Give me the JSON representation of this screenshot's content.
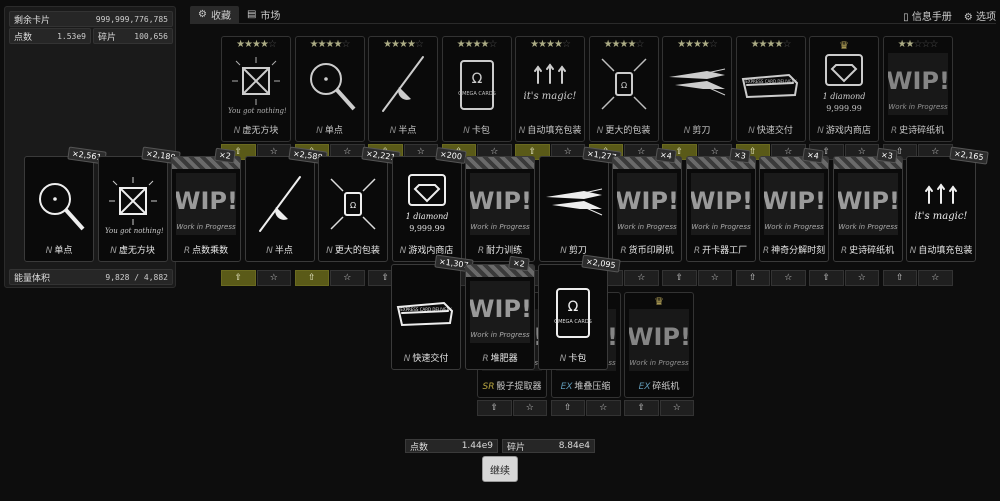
{
  "sidebar": {
    "stats": [
      {
        "label": "剩余卡片",
        "value": "999,999,776,785"
      },
      {
        "label": "点数",
        "value": "1.53e9"
      },
      {
        "label": "碎片",
        "value": "100,656"
      },
      {
        "label": "能量体积",
        "value": "9,828 / 4,882"
      }
    ]
  },
  "tabs": [
    {
      "label": "收藏",
      "icon": "gear-icon"
    },
    {
      "label": "市场",
      "icon": "market-icon"
    }
  ],
  "top_right": [
    {
      "label": "信息手册",
      "icon": "book-icon"
    },
    {
      "label": "选项",
      "icon": "gear-icon"
    }
  ],
  "back_cards": [
    {
      "name": "虚无方块",
      "rarity": "N",
      "stars": 4,
      "art": "box"
    },
    {
      "name": "单点",
      "rarity": "N",
      "stars": 4,
      "art": "dot"
    },
    {
      "name": "半点",
      "rarity": "N",
      "stars": 4,
      "art": "half"
    },
    {
      "name": "卡包",
      "rarity": "N",
      "stars": 4,
      "art": "pack"
    },
    {
      "name": "自动填充包装",
      "rarity": "N",
      "stars": 4,
      "art": "magic"
    },
    {
      "name": "更大的包装",
      "rarity": "N",
      "stars": 4,
      "art": "bigger"
    },
    {
      "name": "剪刀",
      "rarity": "N",
      "stars": 4,
      "art": "scissors"
    },
    {
      "name": "快速交付",
      "rarity": "N",
      "stars": 4,
      "art": "express"
    },
    {
      "name": "游戏内商店",
      "rarity": "N",
      "crown": true,
      "art": "diamond"
    },
    {
      "name": "史诗碎纸机",
      "rarity": "R",
      "stars": 2,
      "art": "wip"
    }
  ],
  "star_total": 5,
  "front_cards": [
    {
      "name": "单点",
      "rarity": "N",
      "count": "×2,561",
      "art": "dot"
    },
    {
      "name": "虚无方块",
      "rarity": "N",
      "count": "×2,189",
      "art": "box"
    },
    {
      "name": "点数乘数",
      "rarity": "R",
      "count": "×2",
      "art": "wip",
      "striped": true
    },
    {
      "name": "半点",
      "rarity": "N",
      "count": "×2,588",
      "art": "half"
    },
    {
      "name": "更大的包装",
      "rarity": "N",
      "count": "×2,221",
      "art": "bigger"
    },
    {
      "name": "游戏内商店",
      "rarity": "N",
      "count": "×200",
      "art": "diamond"
    },
    {
      "name": "耐力训练",
      "rarity": "R",
      "count": "",
      "art": "wip",
      "striped": true
    },
    {
      "name": "剪刀",
      "rarity": "N",
      "count": "×1,277",
      "art": "scissors"
    },
    {
      "name": "货币印刷机",
      "rarity": "R",
      "count": "×4",
      "art": "wip",
      "striped": true
    },
    {
      "name": "开卡器工厂",
      "rarity": "R",
      "count": "×3",
      "art": "wip",
      "striped": true
    },
    {
      "name": "神奇分解时刻",
      "rarity": "R",
      "count": "×4",
      "art": "wip",
      "striped": true
    },
    {
      "name": "史诗碎纸机",
      "rarity": "R",
      "count": "×3",
      "art": "wip",
      "striped": true
    },
    {
      "name": "自动填充包装",
      "rarity": "N",
      "count": "×2,165",
      "art": "magic"
    }
  ],
  "third_row": [
    {
      "name": "快速交付",
      "rarity": "N",
      "count": "×1,307",
      "art": "express"
    },
    {
      "name": "堆肥器",
      "rarity": "R",
      "count": "×2",
      "art": "wip",
      "striped": true
    },
    {
      "name": "卡包",
      "rarity": "N",
      "count": "×2,095",
      "art": "pack"
    }
  ],
  "collection_extras": [
    {
      "name": "骰子提取器",
      "rarity": "SR"
    },
    {
      "name": "堆叠压缩",
      "rarity": "EX"
    },
    {
      "name": "碎纸机",
      "rarity": "EX",
      "crown": true
    }
  ],
  "wip_text": "WIP!",
  "wip_sub": "Work in Progress",
  "art_text": {
    "omega": "Ω",
    "omega_cards": "OMEGA CARDS",
    "magic": "it's magic!",
    "diamond": "1 diamond",
    "diamond_price": "9,999.99",
    "express": "EXPRESS CARD DELIVERY",
    "you_got": "You got nothing!"
  },
  "bottom": {
    "points_label": "点数",
    "points_value": "1.44e9",
    "shards_label": "碎片",
    "shards_value": "8.84e4",
    "continue_label": "继续"
  }
}
